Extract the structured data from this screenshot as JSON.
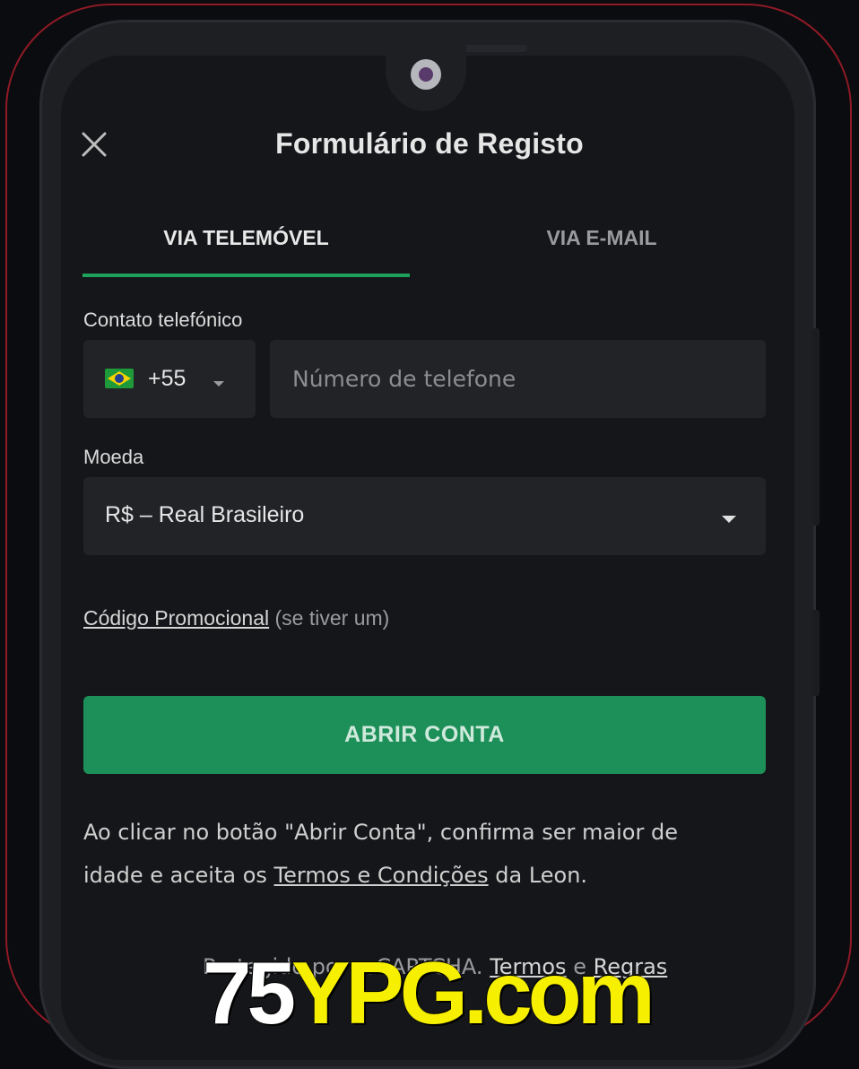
{
  "header": {
    "title": "Formulário de Registo"
  },
  "tabs": [
    {
      "label": "VIA TELEMÓVEL",
      "active": true
    },
    {
      "label": "VIA E-MAIL",
      "active": false
    }
  ],
  "phone": {
    "label": "Contato telefónico",
    "country_code": "+55",
    "country_flag": "brazil-flag-icon",
    "placeholder": "Número de telefone",
    "value": ""
  },
  "currency": {
    "label": "Moeda",
    "selected": "R$ – Real Brasileiro"
  },
  "promo": {
    "link": "Código Promocional",
    "hint": "(se tiver um)"
  },
  "submit": {
    "label": "ABRIR CONTA"
  },
  "terms": {
    "text_before": "Ao clicar no botão \"Abrir Conta\", confirma ser maior de idade e aceita os ",
    "link": "Termos e Condições",
    "text_after": " da Leon."
  },
  "footer": {
    "text_before": "Protegido por reCAPTCHA.",
    "terms_link": "Termos",
    "conj": "e",
    "rules_link": "Regras"
  },
  "watermark": {
    "part1": "75",
    "part2": "YPG.com"
  },
  "colors": {
    "accent": "#1fa15e",
    "button": "#1d8f58",
    "background": "#151619",
    "field": "#222327",
    "frame": "#8e1a26",
    "watermark_yellow": "#f6f000"
  }
}
